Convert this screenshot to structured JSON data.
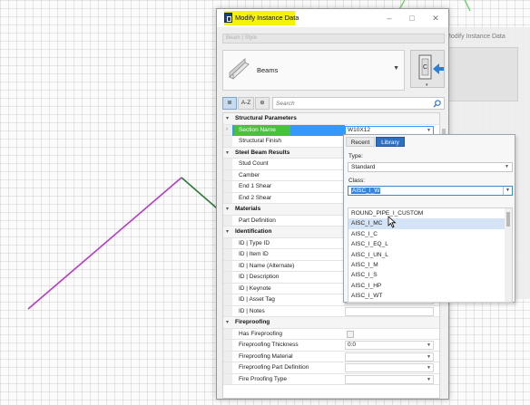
{
  "background": {
    "shadow_window_title": "Modify Instance Data"
  },
  "dialog": {
    "title": "Modify Instance Data",
    "pick_placeholder": "Beam | Style",
    "beams_label": "Beams",
    "search_placeholder": "Search",
    "toolbar": {
      "categorized_label": "≣",
      "az_label": "A-Z",
      "filter_label": "⊕"
    },
    "rows": [
      {
        "kind": "cat",
        "label": "Structural Parameters"
      },
      {
        "kind": "sel",
        "label": "Section Name",
        "value": "W10X12"
      },
      {
        "kind": "prop",
        "label": "Structural Finish",
        "value": ""
      },
      {
        "kind": "cat",
        "label": "Steel Beam Results"
      },
      {
        "kind": "prop",
        "label": "Stud Count",
        "value": ""
      },
      {
        "kind": "prop",
        "label": "Camber",
        "value": ""
      },
      {
        "kind": "prop",
        "label": "End 1 Shear",
        "value": ""
      },
      {
        "kind": "prop",
        "label": "End 2 Shear",
        "value": ""
      },
      {
        "kind": "cat",
        "label": "Materials"
      },
      {
        "kind": "prop",
        "label": "Part Definition",
        "value": ""
      },
      {
        "kind": "cat",
        "label": "Identification"
      },
      {
        "kind": "prop",
        "label": "ID | Type ID",
        "value": ""
      },
      {
        "kind": "prop",
        "label": "ID | Item ID",
        "value": ""
      },
      {
        "kind": "prop",
        "label": "ID | Name (Alternate)",
        "value": ""
      },
      {
        "kind": "prop",
        "label": "ID | Description",
        "value": ""
      },
      {
        "kind": "prop",
        "label": "ID | Keynote",
        "value": ""
      },
      {
        "kind": "prop",
        "label": "ID | Asset Tag",
        "value": ""
      },
      {
        "kind": "prop",
        "label": "ID | Notes",
        "value": ""
      },
      {
        "kind": "cat",
        "label": "Fireproofing"
      },
      {
        "kind": "check",
        "label": "Has Fireproofing",
        "value": ""
      },
      {
        "kind": "prop",
        "label": "Fireproofing Thickness",
        "value": "0:0"
      },
      {
        "kind": "prop",
        "label": "Fireproofing Material",
        "value": ""
      },
      {
        "kind": "prop",
        "label": "Fireproofing Part Definition",
        "value": ""
      },
      {
        "kind": "prop",
        "label": "Fire Proofing Type",
        "value": ""
      }
    ]
  },
  "popup": {
    "tab_recent": "Recent",
    "tab_library": "Library",
    "type_label": "Type:",
    "type_value": "Standard",
    "class_label": "Class:",
    "class_value": "AISC_I_W",
    "list": [
      "ROUND_PIPE_I_CUSTOM",
      "AISC_I_MC",
      "AISC_I_C",
      "AISC_I_EQ_L",
      "AISC_I_UN_L",
      "AISC_I_M",
      "AISC_I_S",
      "AISC_I_HP",
      "AISC_I_WT"
    ],
    "hover_index": 1
  },
  "colors": {
    "title_highlight": "#f4f20a",
    "section_highlight": "#4bbf3e",
    "selection_blue": "#3399ff",
    "library_tab": "#2d6fc1",
    "magenta_line": "#b53cc6",
    "green_line": "#2f7a3a"
  },
  "icons": {
    "app": "app-icon",
    "search": "search-icon",
    "beam": "beam-icon",
    "place": "place-tool-icon"
  }
}
